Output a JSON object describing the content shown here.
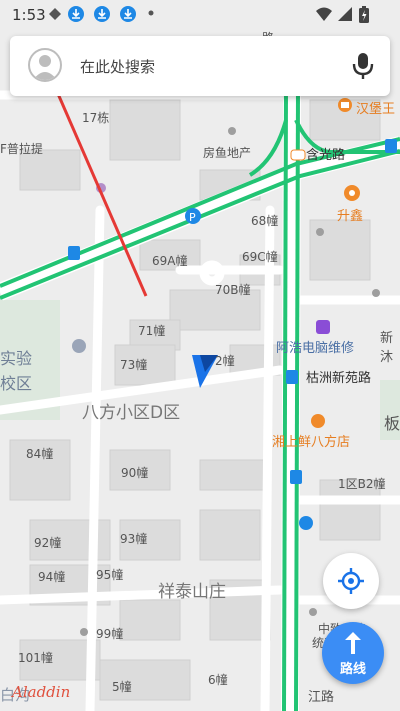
{
  "status_bar": {
    "time": "1:53",
    "icons": [
      "diamond-icon",
      "download-icon",
      "download-icon",
      "download-icon",
      "dot-icon",
      "wifi-icon",
      "signal-icon",
      "battery-charging-icon"
    ]
  },
  "search": {
    "placeholder": "在此处搜索"
  },
  "map_labels": {
    "poi_hamburger": "汉堡王",
    "road_hanguang": "含光路",
    "poi_shengxin": "升鑫",
    "poi_fangyu": "房鱼地产",
    "poi_pulati": "F普拉提",
    "bld_17": "17栋",
    "bld_68": "68幢",
    "bld_69a": "69A幢",
    "bld_69c": "69C幢",
    "bld_70b": "70B幢",
    "bld_71": "71幢",
    "bld_73": "73幢",
    "bld_72": "2幢",
    "poi_aohao": "阿浩电脑维修",
    "poi_xinjie": "新沐",
    "road_zhuzhou": "枯洲新苑路",
    "area_bafang": "八方小区D区",
    "school_1": "实验",
    "school_2": "校区",
    "poi_xiangshang": "湘上鲜八方店",
    "right_ban": "板",
    "bld_84": "84幢",
    "bld_90": "90幢",
    "bld_1qu": "1区B2幢",
    "bld_92": "92幢",
    "bld_93": "93幢",
    "bld_94": "94幢",
    "bld_95": "95幢",
    "area_xiangtai": "祥泰山庄",
    "bld_99": "99幢",
    "bld_101": "101幢",
    "bld_5": "5幢",
    "bld_6": "6幢",
    "poi_zhongzhi": "中致和传",
    "poi_jiaoyu": "统教育",
    "road_jiang": "江路",
    "bottom_bai": "白沟",
    "top_lu": "路"
  },
  "buttons": {
    "route_label": "路线",
    "locate": "locate-crosshair-icon"
  },
  "watermark": "Aladdin",
  "colors": {
    "road_green": "#22c474",
    "road_white": "#ffffff",
    "annotation_arrow": "#e53935",
    "location_marker": "#1a73e8",
    "route_button": "#3b8df5",
    "poi_orange": "#f08a2a",
    "poi_purple": "#8a4dd6",
    "bus_blue": "#1e88e5"
  }
}
